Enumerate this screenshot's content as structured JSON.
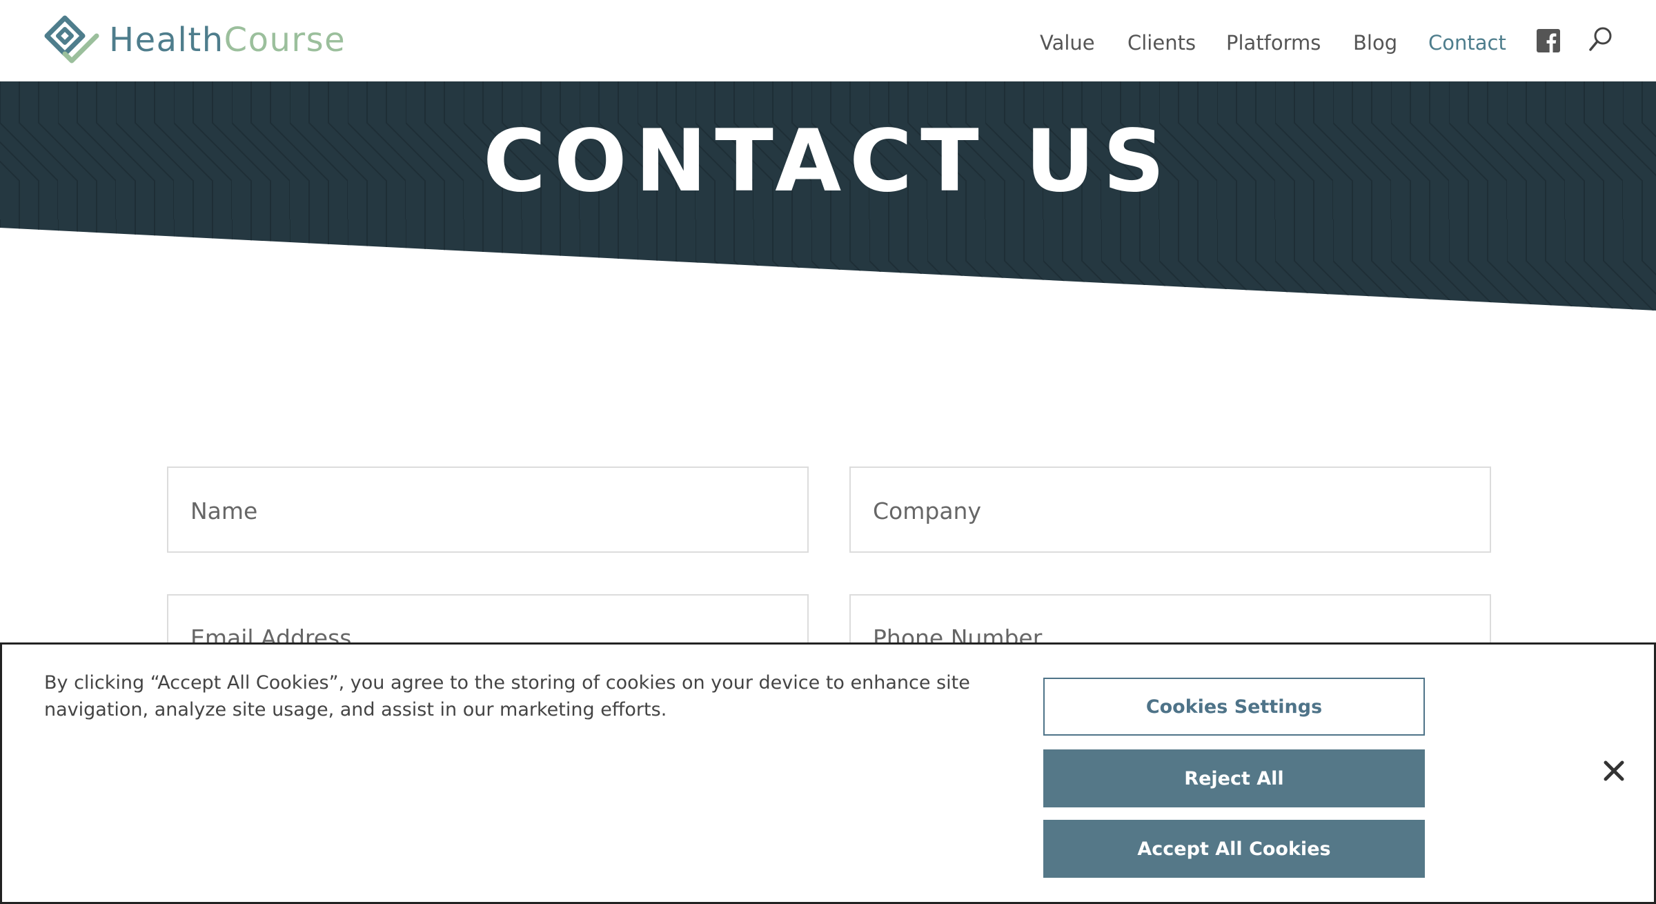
{
  "header": {
    "logo": {
      "part1": "Health",
      "part2": "Course"
    },
    "nav": [
      {
        "label": "Value"
      },
      {
        "label": "Clients"
      },
      {
        "label": "Platforms"
      },
      {
        "label": "Blog"
      },
      {
        "label": "Contact",
        "active": true
      }
    ],
    "icons": [
      "facebook-icon",
      "search-icon"
    ]
  },
  "hero": {
    "title": "CONTACT US",
    "background_color": "#253841"
  },
  "form": {
    "name_placeholder": "Name",
    "company_placeholder": "Company",
    "email_placeholder": "Email Address",
    "phone_placeholder": "Phone Number"
  },
  "cookie_banner": {
    "message": "By clicking “Accept All Cookies”, you agree to the storing of cookies on your device to enhance site navigation, analyze site usage, and assist in our marketing efforts.",
    "settings_label": "Cookies Settings",
    "reject_label": "Reject All",
    "accept_label": "Accept All Cookies",
    "close_icon": "close-icon"
  },
  "colors": {
    "brand_teal": "#4e7d8c",
    "brand_green": "#9bbf9c",
    "button_fill": "#557888",
    "hero_dark": "#253841"
  }
}
